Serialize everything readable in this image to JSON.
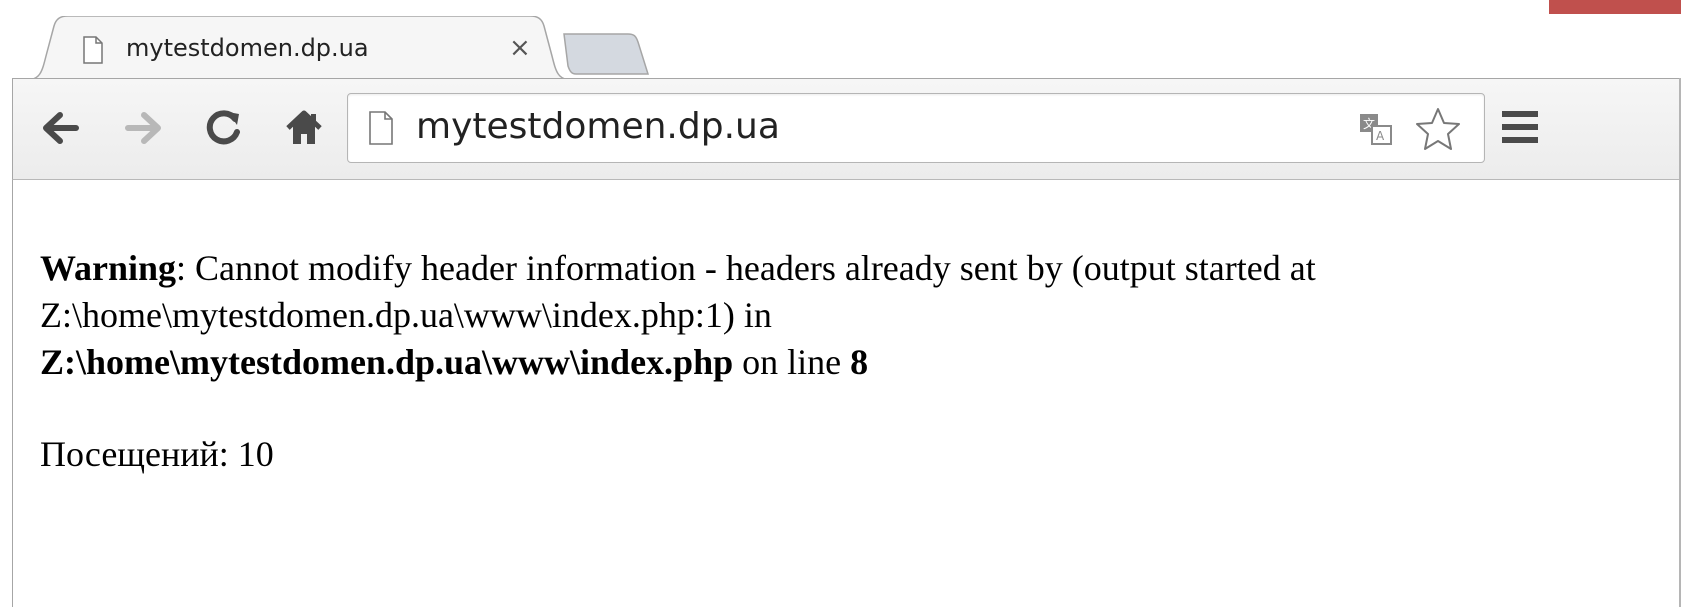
{
  "browser": {
    "tab": {
      "title": "mytestdomen.dp.ua",
      "close_glyph": "×",
      "favicon": "page-icon"
    },
    "toolbar": {
      "back_icon": "arrow-left-icon",
      "forward_icon": "arrow-right-icon",
      "reload_icon": "reload-icon",
      "home_icon": "home-icon",
      "menu_icon": "hamburger-menu-icon"
    },
    "omnibox": {
      "url": "mytestdomen.dp.ua",
      "page_icon": "page-icon",
      "translate_icon": "translate-icon",
      "bookmark_icon": "star-icon"
    }
  },
  "page": {
    "warning": {
      "label": "Warning",
      "message_1": ": Cannot modify header information - headers already sent by (output started at Z:\\home\\mytestdomen.dp.ua\\www\\index.php:1) in",
      "file": "Z:\\home\\mytestdomen.dp.ua\\www\\index.php",
      "on_line_text": " on line ",
      "line_number": "8"
    },
    "visits": "Посещений: 10"
  },
  "colors": {
    "accent_red": "#c0504d",
    "toolbar_bg": "#ececec",
    "border": "#a6a6a6"
  }
}
